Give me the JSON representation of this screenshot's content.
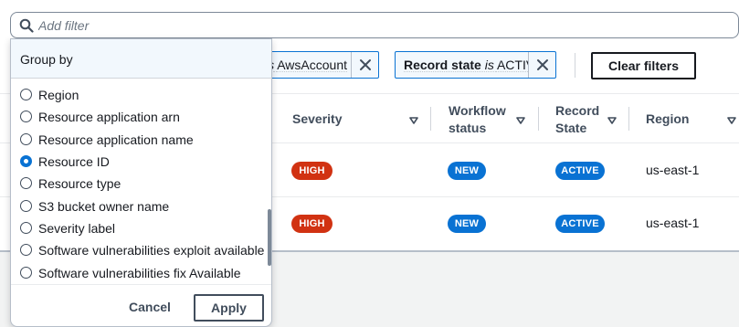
{
  "search": {
    "placeholder": "Add filter",
    "value": "",
    "icon": "search-icon"
  },
  "filters": {
    "tokens": [
      {
        "text_visible_italic": "is",
        "text_visible_value": "AwsAccount"
      },
      {
        "property": "Record state",
        "operator": "is",
        "value": "ACTIVE"
      }
    ],
    "clear_label": "Clear filters"
  },
  "table": {
    "columns": [
      {
        "label": "Severity"
      },
      {
        "label": "Workflow status",
        "line1": "Workflow",
        "line2": "status"
      },
      {
        "label": "Record State",
        "line1": "Record",
        "line2": "State"
      },
      {
        "label": "Region"
      }
    ],
    "rows": [
      {
        "severity": "HIGH",
        "workflow_status": "NEW",
        "record_state": "ACTIVE",
        "region": "us-east-1"
      },
      {
        "severity": "HIGH",
        "workflow_status": "NEW",
        "record_state": "ACTIVE",
        "region": "us-east-1"
      }
    ]
  },
  "dropdown": {
    "header": "Group by",
    "options": [
      {
        "label": "Region",
        "checked": false
      },
      {
        "label": "Resource application arn",
        "checked": false
      },
      {
        "label": "Resource application name",
        "checked": false
      },
      {
        "label": "Resource ID",
        "checked": true
      },
      {
        "label": "Resource type",
        "checked": false
      },
      {
        "label": "S3 bucket owner name",
        "checked": false
      },
      {
        "label": "Severity label",
        "checked": false
      },
      {
        "label": "Software vulnerabilities exploit available",
        "checked": false
      },
      {
        "label": "Software vulnerabilities fix Available",
        "checked": false
      }
    ],
    "cancel_label": "Cancel",
    "apply_label": "Apply"
  },
  "colors": {
    "accent": "#0972d3",
    "severity_high": "#d13212",
    "token_bg": "#f2f8fd"
  }
}
